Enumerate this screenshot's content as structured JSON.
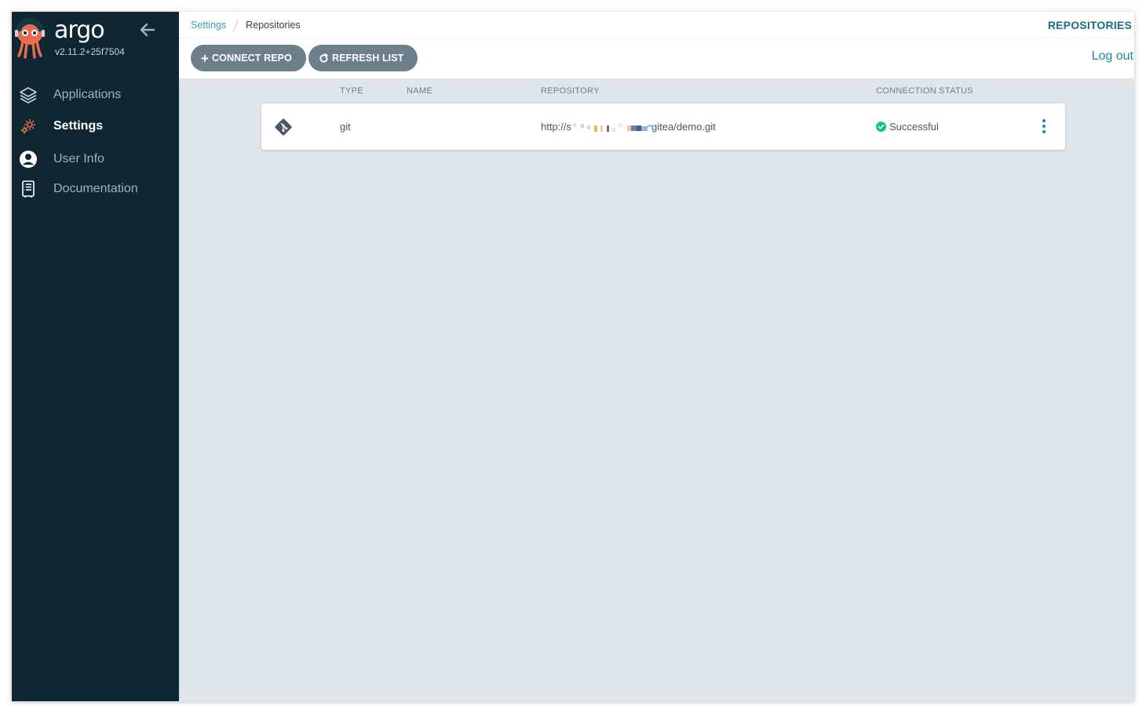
{
  "brand": {
    "name": "argo",
    "version": "v2.11.2+25f7504"
  },
  "sidebar": {
    "items": [
      {
        "label": "Applications",
        "icon": "layers-icon",
        "active": false
      },
      {
        "label": "Settings",
        "icon": "gears-icon",
        "active": true
      },
      {
        "label": "User Info",
        "icon": "user-circle-icon",
        "active": false
      },
      {
        "label": "Documentation",
        "icon": "book-icon",
        "active": false
      }
    ]
  },
  "breadcrumb": {
    "parent": "Settings",
    "current": "Repositories"
  },
  "header": {
    "title": "REPOSITORIES",
    "logout": "Log out"
  },
  "toolbar": {
    "connect_label": "CONNECT REPO",
    "refresh_label": "REFRESH LIST"
  },
  "table": {
    "columns": [
      "TYPE",
      "NAME",
      "REPOSITORY",
      "CONNECTION STATUS"
    ],
    "rows": [
      {
        "icon": "git-icon",
        "type": "git",
        "name": "",
        "repo_prefix": "http://s",
        "repo_suffix": "gitea/demo.git",
        "status": "Successful"
      }
    ]
  },
  "colors": {
    "sidebar_bg": "#0e2733",
    "accent": "#1a8aa5",
    "button_bg": "#6d7f8b",
    "content_bg": "#dee6eb",
    "success": "#18be94",
    "settings_icon": "#e96d4d"
  }
}
